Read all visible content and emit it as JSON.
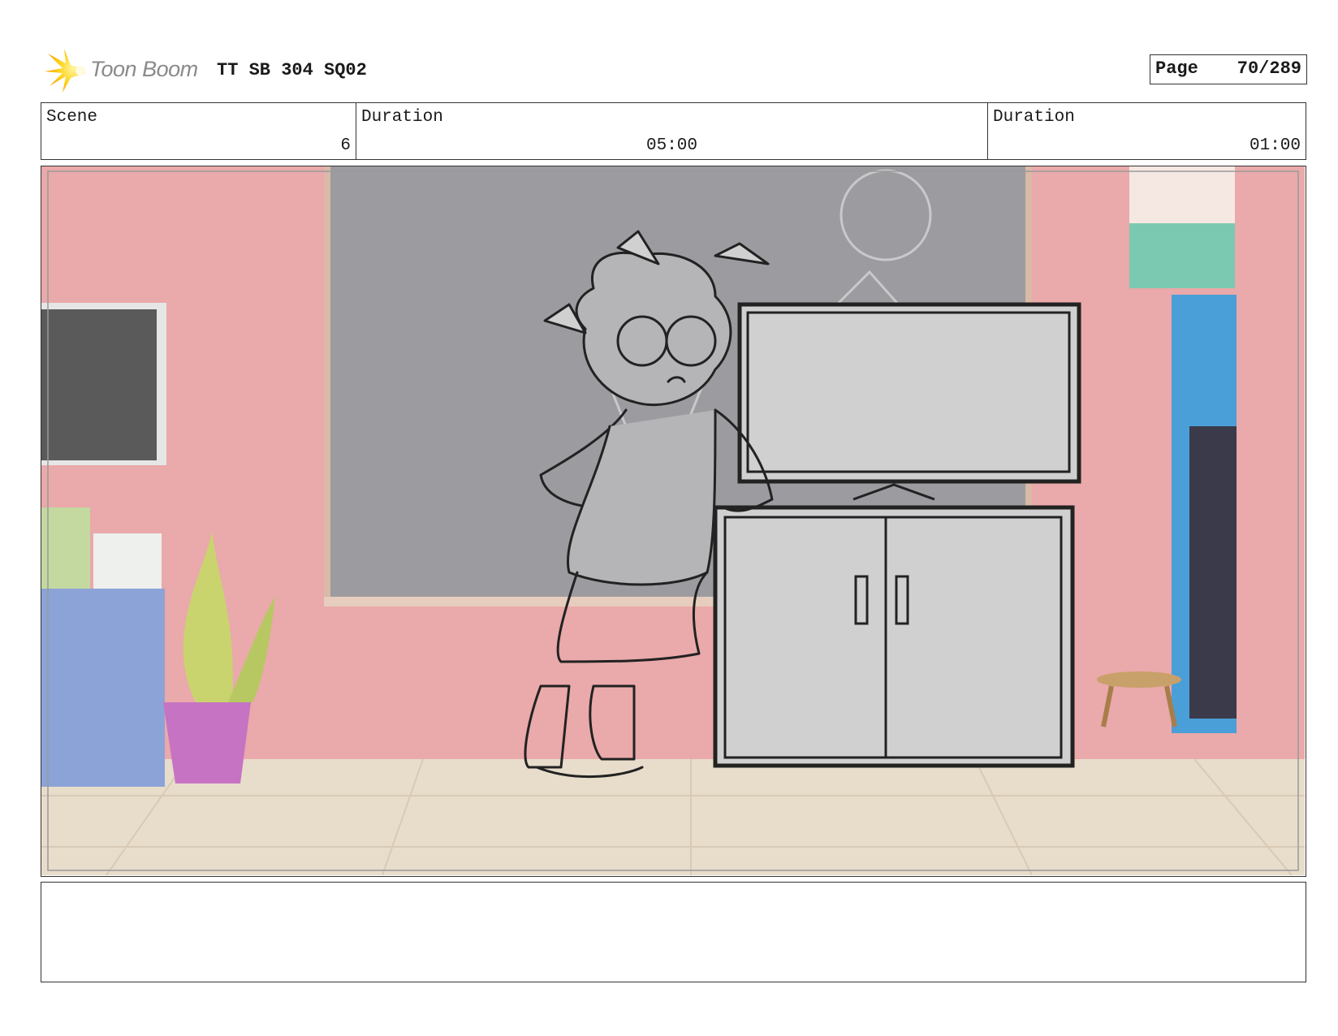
{
  "header": {
    "logo_text": "Toon Boom",
    "logo_icon": "toon-boom-star-icon",
    "title": "TT SB 304 SQ02",
    "page_label": "Page",
    "page_number": "70/289"
  },
  "info": {
    "scene_label": "Scene",
    "scene_value": "6",
    "duration1_label": "Duration",
    "duration1_value": "05:00",
    "duration2_label": "Duration",
    "duration2_value": "01:00"
  },
  "panel": {
    "colors": {
      "wall": "#eaa9aa",
      "chalkboard": "#9c9ca0",
      "floor": "#e8dccb",
      "sketch_fill": "#d0d0d0",
      "line": "#222222"
    }
  },
  "caption": {
    "text": ""
  }
}
